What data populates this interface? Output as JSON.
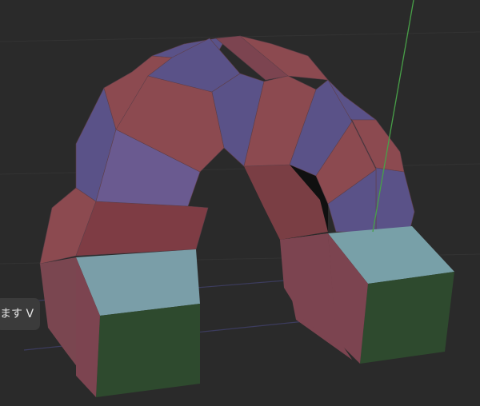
{
  "viewport": {
    "background_color": "#2a2a2a",
    "grid_line_color": "#333333",
    "axis_line_color": "#48a048",
    "floor_line_color": "#3c3c5e"
  },
  "materials": {
    "red_face": "#8c4a50",
    "blue_face": "#5a5288",
    "cube_top": "#78a0a8",
    "cube_side": "#2e4a2e"
  },
  "toast": {
    "text": "ます V"
  }
}
